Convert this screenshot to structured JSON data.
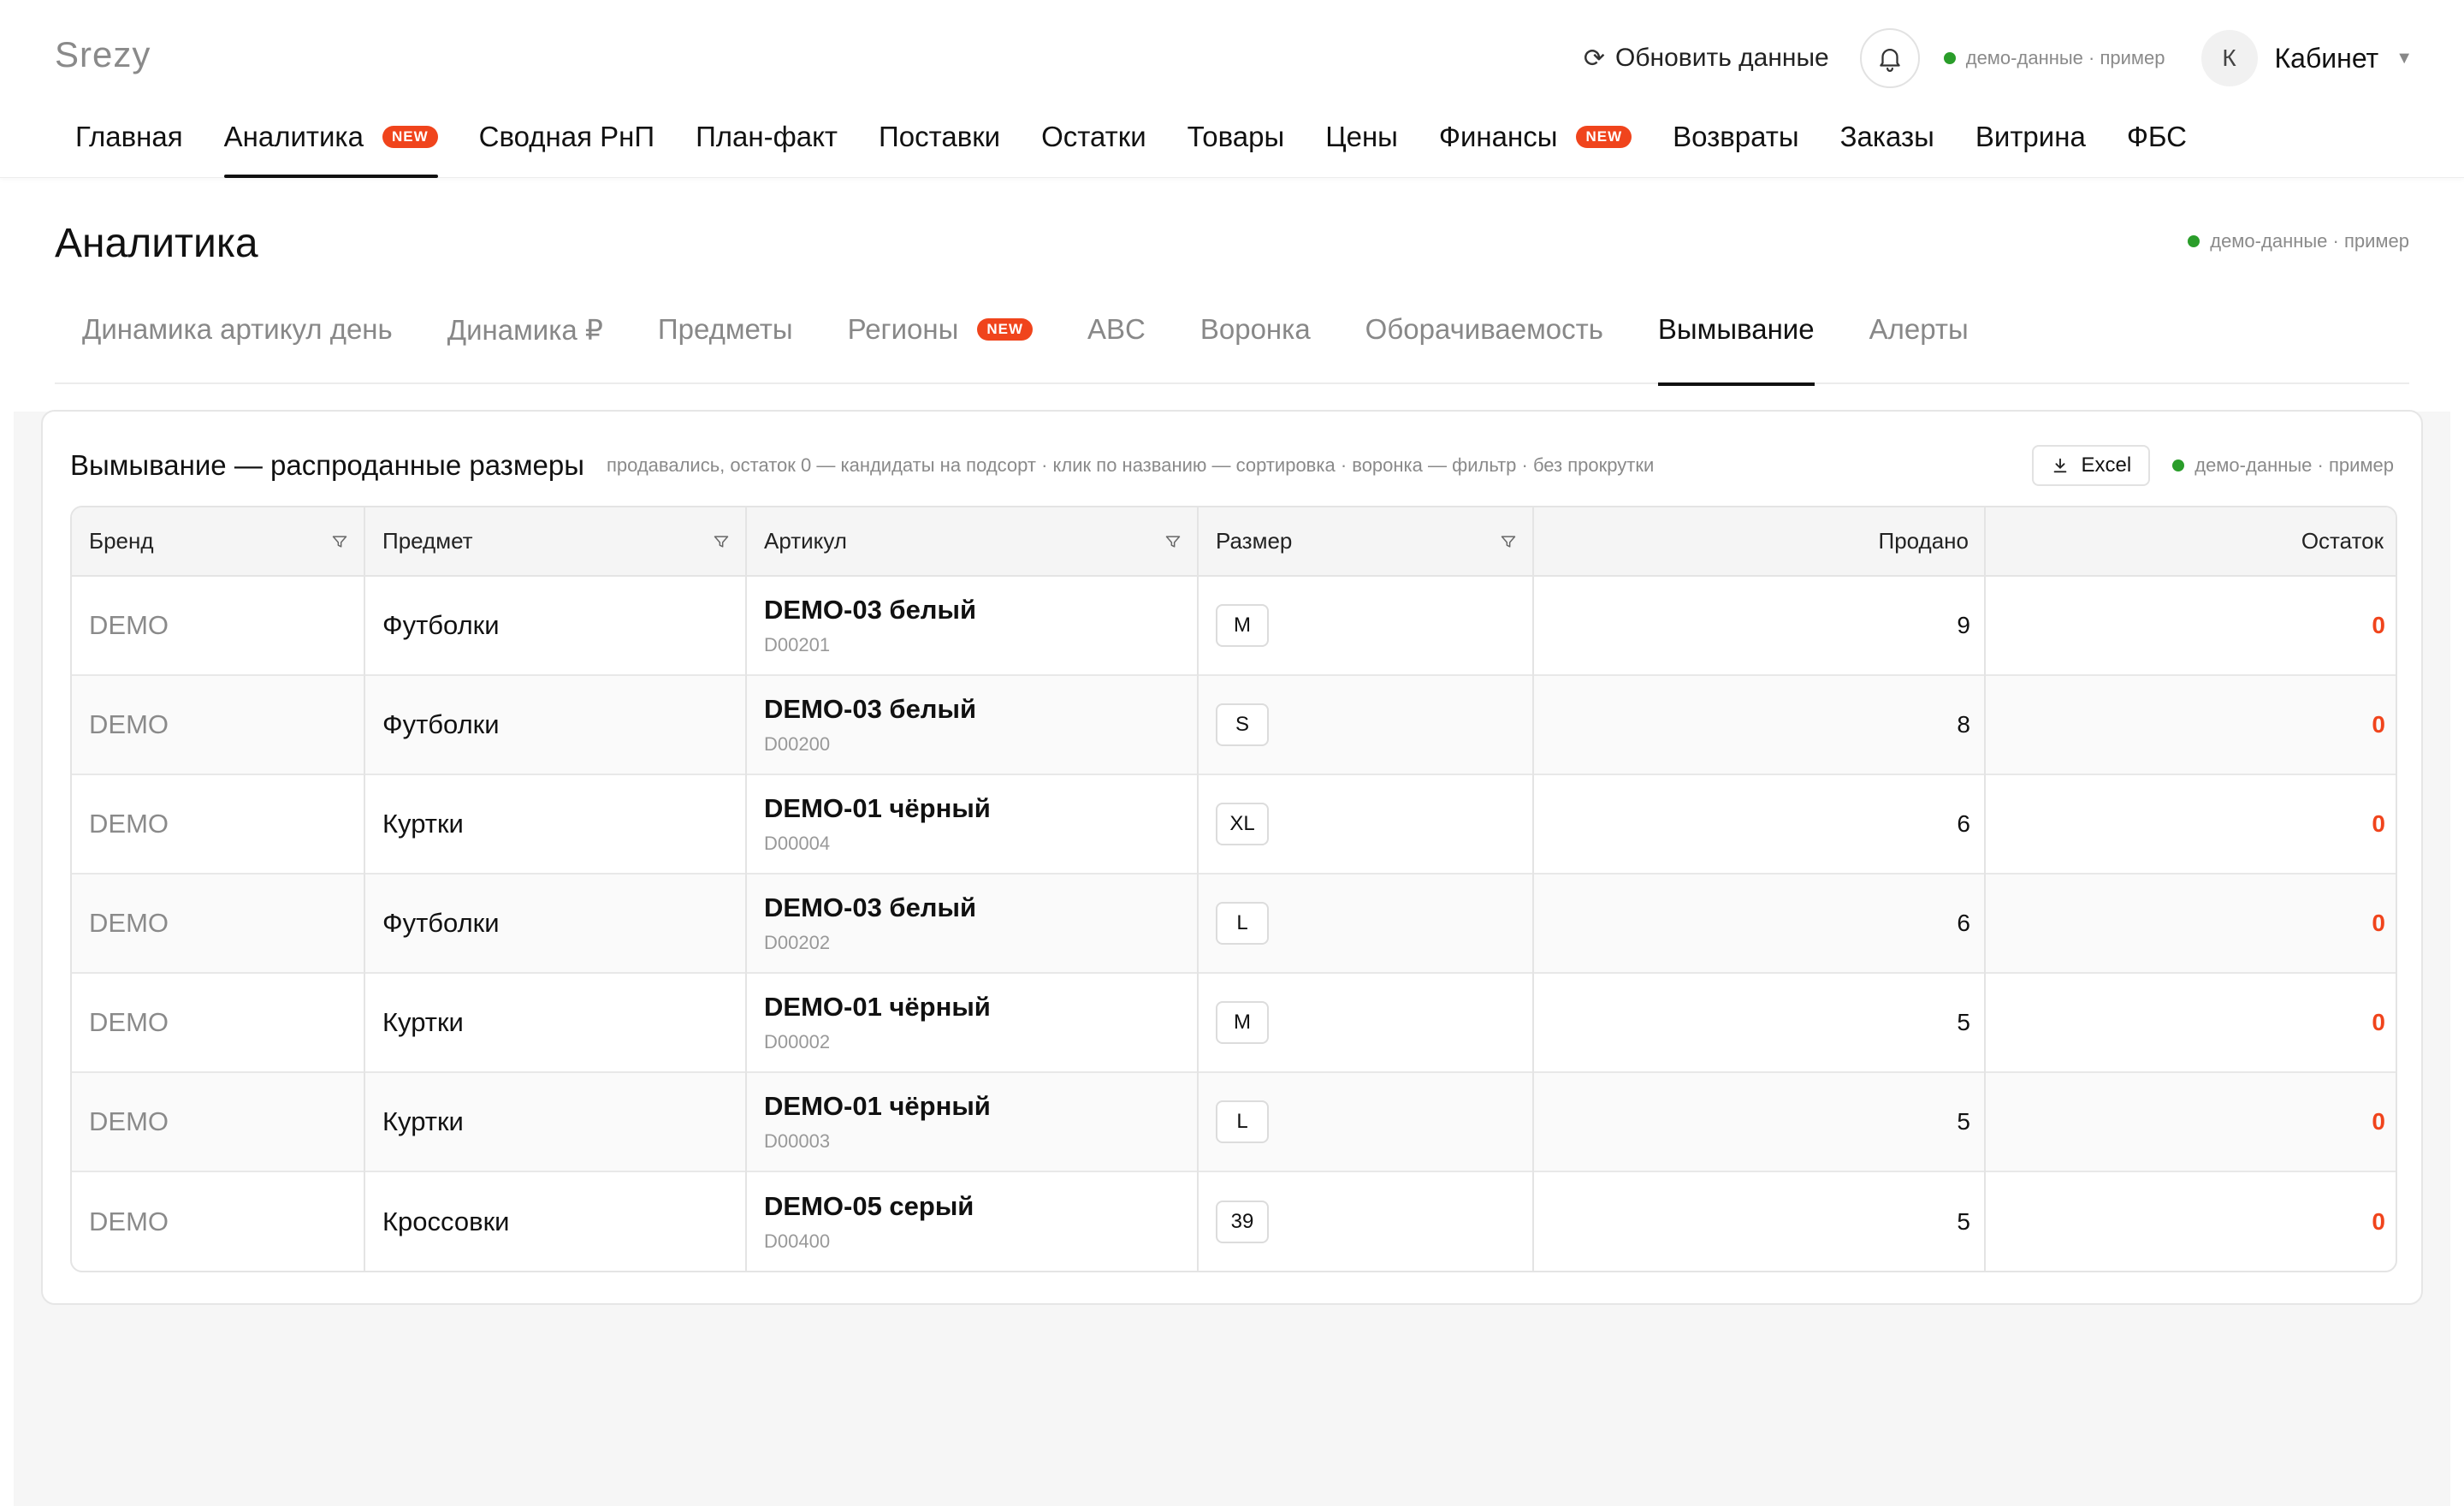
{
  "app": {
    "logo": "Srezy"
  },
  "header": {
    "refresh_label": "Обновить данные",
    "demo_status": "демо-данные · пример",
    "demo_dot_color": "#2a9d2a",
    "cabinet_initial": "К",
    "cabinet_label": "Кабинет",
    "caret": "▼"
  },
  "main_nav": {
    "items": [
      {
        "label": "Главная"
      },
      {
        "label": "Аналитика",
        "badge": "NEW",
        "active": true
      },
      {
        "label": "Сводная РнП"
      },
      {
        "label": "План-факт"
      },
      {
        "label": "Поставки"
      },
      {
        "label": "Остатки"
      },
      {
        "label": "Товары"
      },
      {
        "label": "Цены"
      },
      {
        "label": "Финансы",
        "badge": "NEW"
      },
      {
        "label": "Возвраты"
      },
      {
        "label": "Заказы"
      },
      {
        "label": "Витрина"
      },
      {
        "label": "ФБС"
      }
    ]
  },
  "page": {
    "title": "Аналитика",
    "demo_status": "демо-данные · пример",
    "tabs": [
      {
        "label": "Динамика артикул день"
      },
      {
        "label": "Динамика ₽"
      },
      {
        "label": "Предметы"
      },
      {
        "label": "Регионы",
        "badge": "NEW"
      },
      {
        "label": "ABC"
      },
      {
        "label": "Воронка"
      },
      {
        "label": "Оборачиваемость"
      },
      {
        "label": "Вымывание",
        "active": true
      },
      {
        "label": "Алерты"
      }
    ]
  },
  "card": {
    "title": "Вымывание — распроданные размеры",
    "hint": "продавались, остаток 0 — кандидаты на подсорт · клик по названию — сортировка · воронка — фильтр · без прокрутки",
    "excel_label": "Excel",
    "demo_status": "демо-данные · пример"
  },
  "table": {
    "columns": {
      "brand": "Бренд",
      "subject": "Предмет",
      "article": "Артикул",
      "size": "Размер",
      "sold": "Продано",
      "stock": "Остаток"
    },
    "rows": [
      {
        "brand": "DEMO",
        "subject": "Футболки",
        "article": "DEMO-03 белый",
        "code": "D00201",
        "size": "M",
        "sold": "9",
        "stock": "0"
      },
      {
        "brand": "DEMO",
        "subject": "Футболки",
        "article": "DEMO-03 белый",
        "code": "D00200",
        "size": "S",
        "sold": "8",
        "stock": "0"
      },
      {
        "brand": "DEMO",
        "subject": "Куртки",
        "article": "DEMO-01 чёрный",
        "code": "D00004",
        "size": "XL",
        "sold": "6",
        "stock": "0"
      },
      {
        "brand": "DEMO",
        "subject": "Футболки",
        "article": "DEMO-03 белый",
        "code": "D00202",
        "size": "L",
        "sold": "6",
        "stock": "0"
      },
      {
        "brand": "DEMO",
        "subject": "Куртки",
        "article": "DEMO-01 чёрный",
        "code": "D00002",
        "size": "M",
        "sold": "5",
        "stock": "0"
      },
      {
        "brand": "DEMO",
        "subject": "Куртки",
        "article": "DEMO-01 чёрный",
        "code": "D00003",
        "size": "L",
        "sold": "5",
        "stock": "0"
      },
      {
        "brand": "DEMO",
        "subject": "Кроссовки",
        "article": "DEMO-05 серый",
        "code": "D00400",
        "size": "39",
        "sold": "5",
        "stock": "0"
      }
    ]
  },
  "colors": {
    "accent_badge": "#f0441c",
    "zero_stock": "#f0441c",
    "demo_dot": "#2a9d2a"
  },
  "icons": {
    "refresh": "refresh-icon",
    "bell": "bell-icon",
    "filter": "filter-icon",
    "download": "download-icon"
  }
}
